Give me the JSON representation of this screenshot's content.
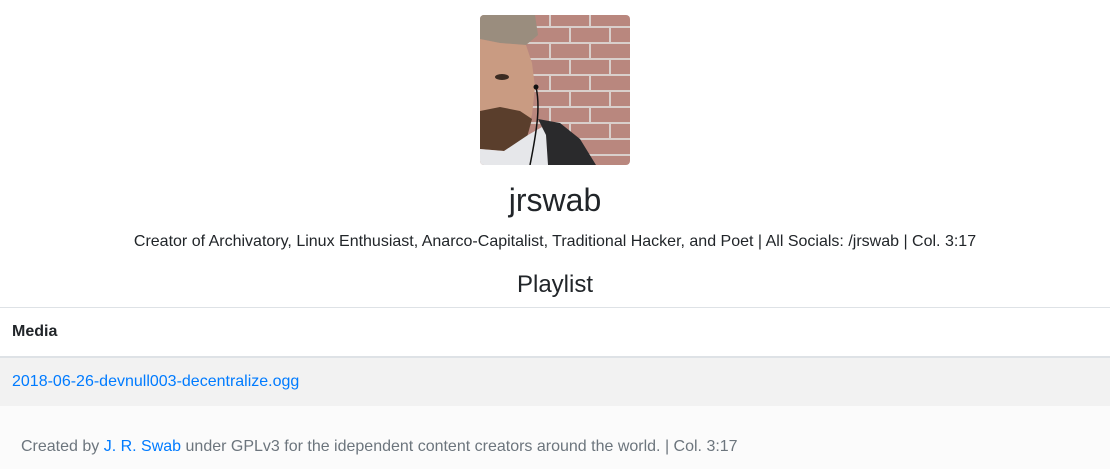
{
  "profile": {
    "avatar_icon": "avatar-photo",
    "username": "jrswab",
    "bio": "Creator of Archivatory, Linux Enthusiast, Anarco-Capitalist, Traditional Hacker, and Poet | All Socials: /jrswab | Col. 3:17"
  },
  "playlist": {
    "title": "Playlist",
    "header": "Media",
    "items": [
      {
        "name": "2018-06-26-devnull003-decentralize.ogg"
      }
    ]
  },
  "footer": {
    "prefix": "Created by ",
    "author_link": "J. R. Swab",
    "suffix": " under GPLv3 for the idependent content creators around the world. | Col. 3:17"
  },
  "colors": {
    "link": "#007bff",
    "text": "#212529",
    "muted": "#6c757d",
    "row_bg": "#f2f2f2"
  }
}
